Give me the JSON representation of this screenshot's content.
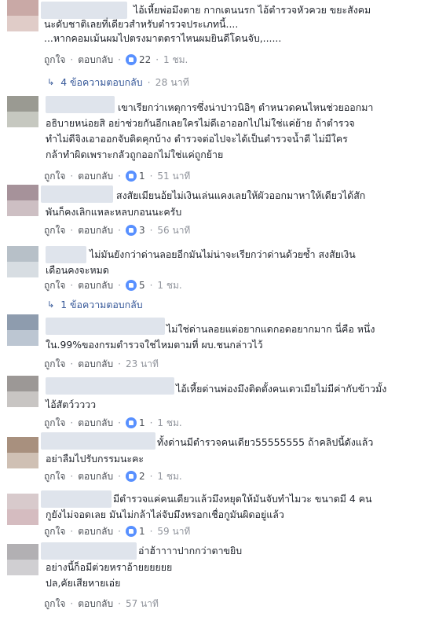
{
  "comments": [
    {
      "avatar_top": "#c9a9a6",
      "avatar_bottom": "#e0ccc8",
      "lines": [
        "ไอ้เหี้ยพ่อมึงตาย กากเดนนรก ไอ้ตำรวจหัวควย ขยะสังคม",
        "นะดับชาติเลยที่เดียวสำหรับตำรวจประเภทนี้....",
        "...หากคอมเม้นผมไปตรงมาตตราไหนผมยินดีโดนจับ,......"
      ],
      "like_label": "ถูกใจ",
      "reply_label": "ตอบกลับ",
      "likes": "22",
      "time": "1 ชม."
    },
    {
      "avatar_top": "#9a9a92",
      "avatar_bottom": "#c6c8c0",
      "lines": [
        "เขาเรียกว่าเหตุการซึ่งน่าปาวนิอิๆ ตำหนวดคนไหนช่วยออกมา",
        "อธิบายหน่อยสิ อย่าช่วยกันอีกเลยใครไม่ดีเอาออกไปไม่ใช่แค่ย้าย ถ้าตำรวจ",
        "ทำไม่ดีจิงเอาออกจับติดคุกบ้าง ตำรวจต่อไปจะได้เป็นตำรวจน้ำดี ไม่มีใคร",
        "กล้าทำผิดเพราะกลัวถูกออกไม่ใช่แค่ถูกย้าย"
      ],
      "like_label": "ถูกใจ",
      "reply_label": "ตอบกลับ",
      "likes": "1",
      "time": "51 นาที"
    },
    {
      "avatar_top": "#a6929a",
      "avatar_bottom": "#cdbfc3",
      "lines": [
        "สงสัยเมียนอ้ยไม่เงินเล่นแคงเลยให้ผัวออกมาหาให้เดียวได้สัก",
        "พันก็คงเลิกแหละหลบกอนนะครับ"
      ],
      "like_label": "ถูกใจ",
      "reply_label": "ตอบกลับ",
      "likes": "3",
      "time": "56 นาที"
    },
    {
      "avatar_top": "#b7c0c8",
      "avatar_bottom": "#d7dde2",
      "lines": [
        "ไม่มันยังกว่าด่านลอยอีกมันไม่น่าจะเรียกว่าด่านด้วยซ้ำ สงสัยเงิน",
        "เดือนคงจะหมด"
      ],
      "like_label": "ถูกใจ",
      "reply_label": "ตอบกลับ",
      "likes": "5",
      "time": "1 ชม."
    },
    {
      "avatar_top": "#8e9cae",
      "avatar_bottom": "#bcc6d2",
      "lines": [
        "ไม่ใช่ด่านลอยแต่อยากแดกอดอยากมาก นี่คือ หนึ่ง",
        "ใน.99%ของกรมตำรวจใช่ไหมตามที่ ผบ.ชนกล่าวไว้"
      ],
      "like_label": "ถูกใจ",
      "reply_label": "ตอบกลับ",
      "likes": "",
      "time": "23 นาที"
    },
    {
      "avatar_top": "#9c9896",
      "avatar_bottom": "#c8c5c3",
      "lines": [
        "ไอ้เหี้ยด่านพ่องมึงติดตั้งคนเดวเมียไม่มีค่ากับข้าวมั้ง",
        "ไอ้สัตว์วววว"
      ],
      "like_label": "ถูกใจ",
      "reply_label": "ตอบกลับ",
      "likes": "1",
      "time": "1 ชม."
    },
    {
      "avatar_top": "#a8907e",
      "avatar_bottom": "#cfc0b4",
      "lines": [
        "ทั้งด่านมีตำรวจคนเดียว55555555 ถ้าคลิปนี้ดังแล้ว",
        "อย่าลืมไปรับกรรมนะคะ"
      ],
      "like_label": "ถูกใจ",
      "reply_label": "ตอบกลับ",
      "likes": "2",
      "time": "1 ชม."
    },
    {
      "avatar_top": "#d8cacc",
      "avatar_bottom": "#d5bcc0",
      "lines": [
        "มีตำรวจแค่คนเดียวแล้วมึงหยุดให้มันจับทำไมวะ ขนาดมี 4 คน",
        "กูยังไม่จอดเลย มันไม่กล้าไล่จับมึงหรอกเชื่อกูมันผิดอยู่แล้ว"
      ],
      "like_label": "ถูกใจ",
      "reply_label": "ตอบกลับ",
      "likes": "1",
      "time": "59 นาที"
    },
    {
      "avatar_top": "#b2b0b3",
      "avatar_bottom": "#d0cfd2",
      "lines": [
        "อ่าฮ้าาาาปากกว่าตาขยิบ",
        "อย่างนี้ก็อมีต่วยหราอ้ายยยยยย",
        "ปล,คัยเสียหายเอ่ย"
      ],
      "like_label": "ถูกใจ",
      "reply_label": "ตอบกลับ",
      "likes": "",
      "time": "57 นาที"
    }
  ],
  "reply_threads": [
    {
      "label": "4 ข้อความตอบกลับ",
      "time": "28 นาที"
    },
    {
      "label": "1 ข้อความตอบกลับ",
      "time": ""
    }
  ],
  "icons": {
    "like": "like-thumb-icon",
    "reply_arrow": "reply-arrow-icon"
  },
  "colors": {
    "link": "#365899",
    "meta": "#90949c",
    "like_badge": "#5890ff"
  }
}
